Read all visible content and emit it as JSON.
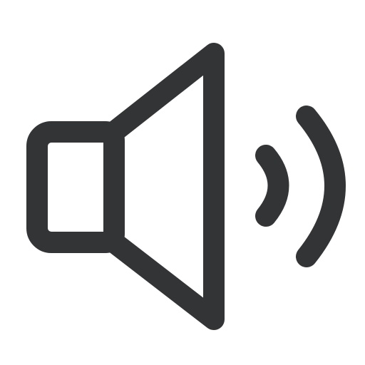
{
  "icon": {
    "name": "speaker-volume-icon",
    "color": "#333436",
    "background": "#ffffff"
  }
}
